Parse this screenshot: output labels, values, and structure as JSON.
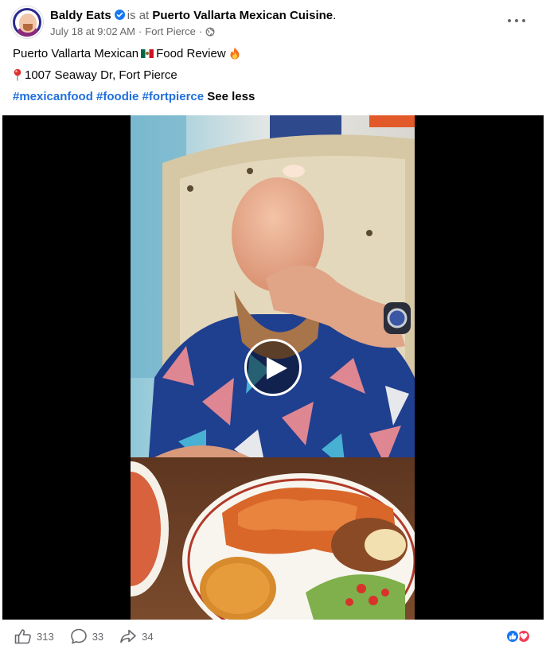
{
  "post": {
    "author": "Baldy Eats",
    "is_at": "is at",
    "place": "Puerto Vallarta Mexican Cuisine",
    "period": ".",
    "date": "July 18 at 9:02 AM",
    "location": "Fort Pierce",
    "dot": "·",
    "line1_a": "Puerto Vallarta Mexican",
    "line1_b": "Food Review",
    "address": "1007 Seaway Dr, Fort Pierce",
    "hashtags": [
      "#mexicanfood",
      "#foodie",
      "#fortpierce"
    ],
    "see_less": "See less"
  },
  "stats": {
    "likes": "313",
    "comments": "33",
    "shares": "34"
  },
  "icons": {
    "avatar": "avatar-image",
    "verified": "verified-badge-icon",
    "globe": "globe-icon",
    "more": "more-options-icon",
    "flag": "mexico-flag-emoji",
    "fire": "fire-emoji",
    "pin": "round-pushpin-emoji",
    "play": "play-icon",
    "like": "like-icon",
    "comment": "comment-icon",
    "share": "share-icon",
    "reaction_like": "like-reaction-icon",
    "reaction_love": "love-reaction-icon"
  },
  "colors": {
    "hashtag": "#216fdb",
    "muted": "#65676b",
    "like": "#1877f2",
    "love": "#f33e58",
    "verified": "#1877f2"
  }
}
